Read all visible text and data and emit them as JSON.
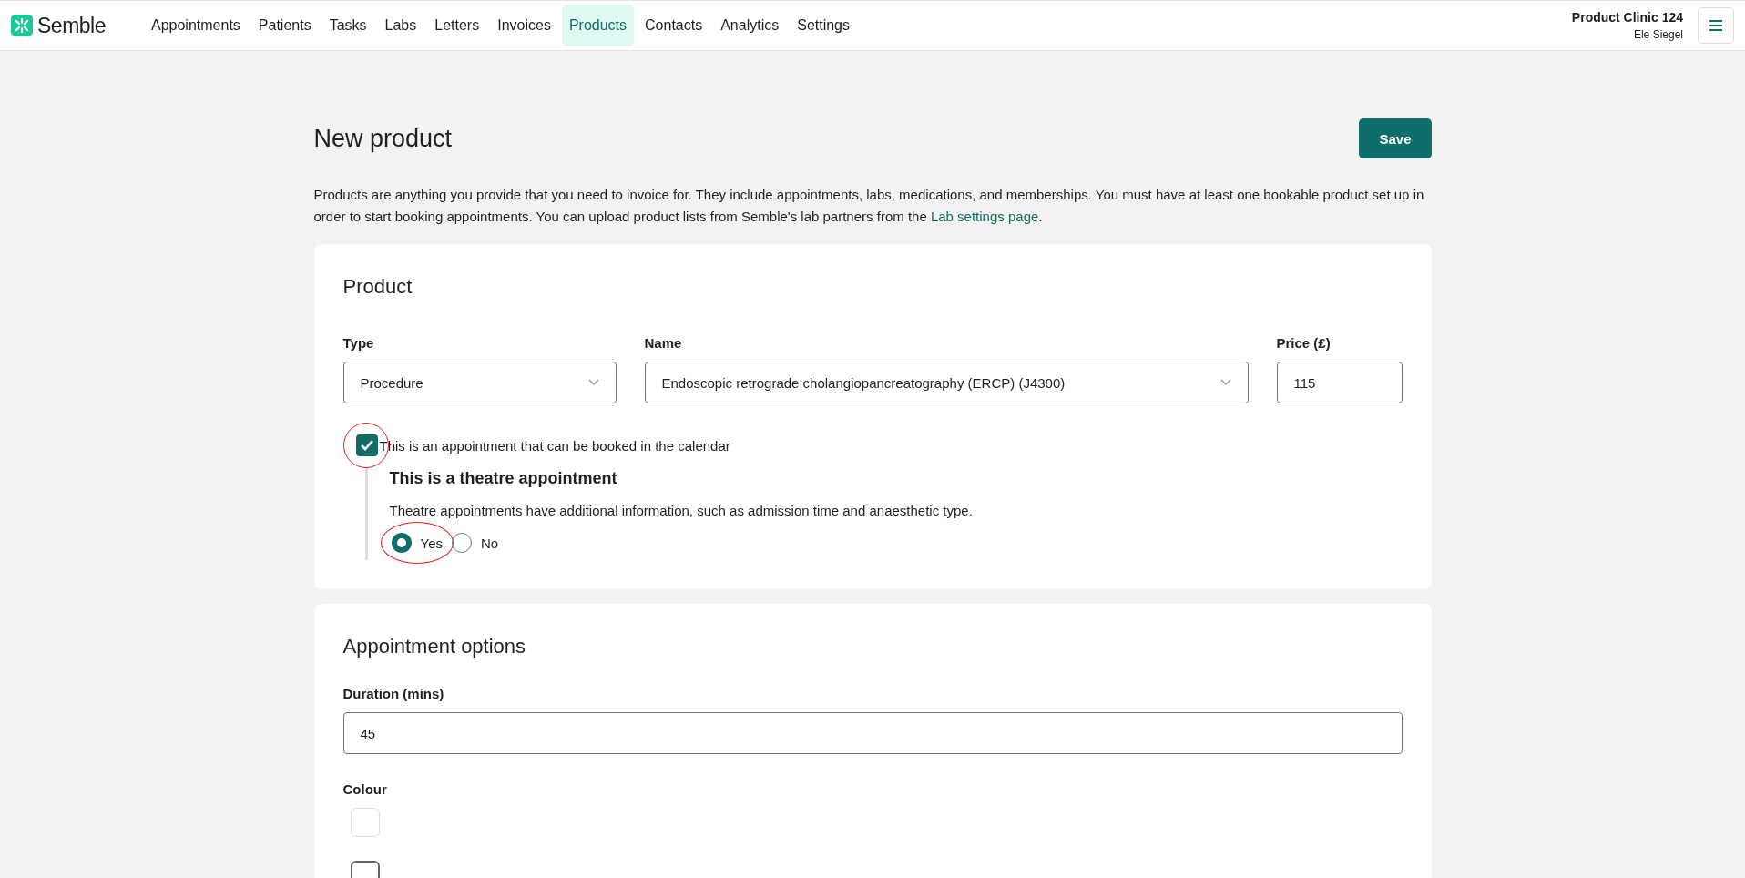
{
  "header": {
    "logo": "Semble",
    "nav": [
      {
        "label": "Appointments",
        "selected": false
      },
      {
        "label": "Patients",
        "selected": false
      },
      {
        "label": "Tasks",
        "selected": false
      },
      {
        "label": "Labs",
        "selected": false
      },
      {
        "label": "Letters",
        "selected": false
      },
      {
        "label": "Invoices",
        "selected": false
      },
      {
        "label": "Products",
        "selected": true
      },
      {
        "label": "Contacts",
        "selected": false
      },
      {
        "label": "Analytics",
        "selected": false
      },
      {
        "label": "Settings",
        "selected": false
      }
    ],
    "clinic": "Product Clinic 124",
    "user": "Ele Siegel"
  },
  "page": {
    "title": "New product",
    "save_button": "Save",
    "description": "Products are anything you provide that you need to invoice for. They include appointments, labs, medications, and memberships. You must have at least one bookable product set up in order to start booking appointments. You can upload product lists from Semble's lab partners from the ",
    "description_link": "Lab settings page",
    "description_end": "."
  },
  "product_card": {
    "heading": "Product",
    "fields": [
      {
        "label": "Type",
        "value": "Procedure",
        "kind": "select"
      },
      {
        "label": "Name",
        "value": "Endoscopic retrograde cholangiopancreatography (ERCP) (J4300)",
        "kind": "select"
      },
      {
        "label": "Price (£)",
        "value": "115",
        "kind": "text"
      }
    ],
    "bookable": {
      "label": "This is an appointment that can be booked in the calendar",
      "checked": true,
      "annotated": true
    },
    "theatre": {
      "heading": "This is a theatre appointment",
      "hint": "Theatre appointments have additional information, such as admission time and anaesthetic type.",
      "options": [
        {
          "label": "Yes",
          "selected": true,
          "annotated": true
        },
        {
          "label": "No",
          "selected": false,
          "annotated": false
        }
      ]
    }
  },
  "options_card": {
    "heading": "Appointment options",
    "duration": {
      "label": "Duration (mins)",
      "value": "45"
    },
    "colour": {
      "label": "Colour",
      "swatches": [
        {
          "color": "#ffffff",
          "selected": false
        },
        {
          "color": "#ffffff",
          "selected": true
        }
      ]
    }
  }
}
